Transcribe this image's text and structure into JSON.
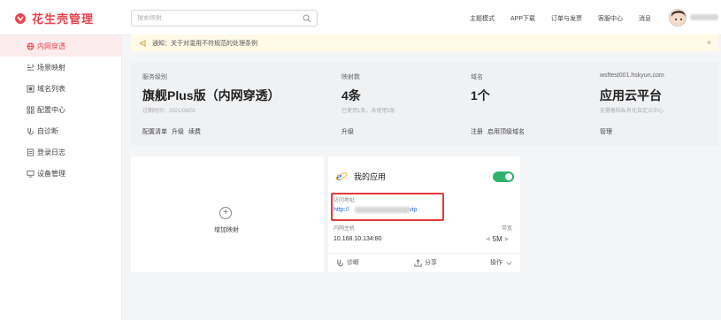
{
  "brand": {
    "name": "花生壳管理",
    "accent": "#e8434e"
  },
  "search": {
    "placeholder": "搜索映射"
  },
  "topnav": [
    "主题模式",
    "APP下载",
    "订单与发票",
    "客服中心",
    "消息"
  ],
  "sidebar": {
    "items": [
      {
        "label": "内网穿透",
        "icon": "globe-icon",
        "active": true
      },
      {
        "label": "场景映射",
        "icon": "scene-icon"
      },
      {
        "label": "域名列表",
        "icon": "domain-icon"
      },
      {
        "label": "配置中心",
        "icon": "grid-icon"
      },
      {
        "label": "自诊断",
        "icon": "diagnose-icon"
      },
      {
        "label": "登录日志",
        "icon": "log-icon"
      },
      {
        "label": "设备管理",
        "icon": "device-icon"
      }
    ]
  },
  "notice": {
    "text": "通知：关于对滥用不符规范的处理条例",
    "close": "×"
  },
  "summary": {
    "service": {
      "header": "服务级别",
      "value": "旗舰Plus版（内网穿透）",
      "sub": "过期时间：2021/09/02",
      "links": [
        "配置清单",
        "升级",
        "续费"
      ]
    },
    "mappings": {
      "header": "映射数",
      "value": "4条",
      "sub": "已使用1条，未使用3条",
      "links": [
        "升级"
      ]
    },
    "domains": {
      "header": "域名",
      "value": "1个",
      "sub": "",
      "links": [
        "注册",
        "启用顶级域名"
      ]
    },
    "cloud": {
      "header": "wsftest001.hskyun.com",
      "value": "应用云平台",
      "sub": "无需着陆私有化自定义中心",
      "links": [
        "管理"
      ]
    }
  },
  "add_card": {
    "label": "增加映射",
    "plus": "+"
  },
  "app_card": {
    "title": "我的应用",
    "enabled": true,
    "access_label": "访问地址",
    "access_url_prefix": "http://",
    "access_url_suffix": "p.vip",
    "host_label": "内网主机",
    "host_value": "10.168.10.134:80",
    "bandwidth_label": "带宽",
    "bandwidth_value": "5M",
    "bw_left": "◀",
    "bw_right": "▶",
    "actions": {
      "diagnose": "诊断",
      "share": "分享",
      "operate": "操作"
    },
    "toggle_color": "#2fb36b",
    "highlight_color": "#e03a3a"
  }
}
